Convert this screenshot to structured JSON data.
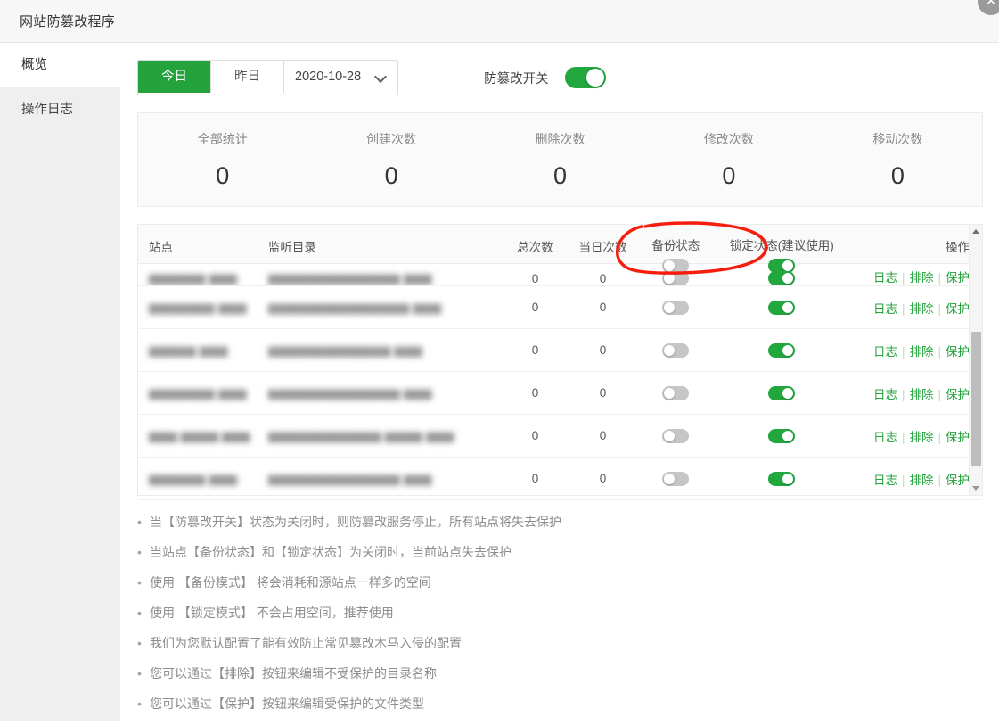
{
  "window": {
    "title": "网站防篡改程序",
    "close_icon": "close-icon"
  },
  "sidebar": {
    "items": [
      {
        "label": "概览",
        "active": true
      },
      {
        "label": "操作日志",
        "active": false
      }
    ]
  },
  "toolbar": {
    "today_label": "今日",
    "yesterday_label": "昨日",
    "date_value": "2020-10-28",
    "date_chevron_icon": "chevron-down-icon",
    "master_switch_label": "防篡改开关",
    "master_switch_state": "on"
  },
  "stats": [
    {
      "label": "全部统计",
      "value": "0"
    },
    {
      "label": "创建次数",
      "value": "0"
    },
    {
      "label": "删除次数",
      "value": "0"
    },
    {
      "label": "修改次数",
      "value": "0"
    },
    {
      "label": "移动次数",
      "value": "0"
    }
  ],
  "table": {
    "columns": {
      "site": "站点",
      "dir": "监听目录",
      "total": "总次数",
      "today": "当日次数",
      "backup": "备份状态",
      "lock": "锁定状态(建议使用)",
      "ops": "操作"
    },
    "header_toggles": {
      "backup_state": "off",
      "lock_state": "on"
    },
    "ops_labels": {
      "log": "日志",
      "exclude": "排除",
      "protect": "保护",
      "separator": "|"
    },
    "rows": [
      {
        "site": "▆▆▆▆▆▆ ▆▆▆",
        "dir": "▆▆▆▆▆▆▆▆▆▆▆▆▆▆ ▆▆▆",
        "total": "0",
        "today": "0",
        "backup": "off",
        "lock": "on",
        "partial": true
      },
      {
        "site": "▆▆▆▆▆▆▆ ▆▆▆",
        "dir": "▆▆▆▆▆▆▆▆▆▆▆▆▆▆▆ ▆▆▆",
        "total": "0",
        "today": "0",
        "backup": "off",
        "lock": "on",
        "partial": false
      },
      {
        "site": "▆▆▆▆▆ ▆▆▆",
        "dir": "▆▆▆▆▆▆▆▆▆▆▆▆▆ ▆▆▆",
        "total": "0",
        "today": "0",
        "backup": "off",
        "lock": "on",
        "partial": false
      },
      {
        "site": "▆▆▆▆▆▆▆ ▆▆▆",
        "dir": "▆▆▆▆▆▆▆▆▆▆▆▆▆▆ ▆▆▆",
        "total": "0",
        "today": "0",
        "backup": "off",
        "lock": "on",
        "partial": false
      },
      {
        "site": "▆▆▆ ▆▆▆▆ ▆▆▆",
        "dir": "▆▆▆▆▆▆▆▆▆▆▆▆ ▆▆▆▆ ▆▆▆",
        "total": "0",
        "today": "0",
        "backup": "off",
        "lock": "on",
        "partial": false
      },
      {
        "site": "▆▆▆▆▆▆ ▆▆▆",
        "dir": "▆▆▆▆▆▆▆▆▆▆▆▆▆▆ ▆▆▆",
        "total": "0",
        "today": "0",
        "backup": "off",
        "lock": "on",
        "partial": false
      }
    ],
    "scrollbar": {
      "up_icon": "scroll-up-arrow-icon",
      "down_icon": "scroll-down-arrow-icon"
    }
  },
  "notes": {
    "bullet": "•",
    "items": [
      "当【防篡改开关】状态为关闭时，则防篡改服务停止，所有站点将失去保护",
      "当站点【备份状态】和【锁定状态】为关闭时，当前站点失去保护",
      "使用 【备份模式】 将会消耗和源站点一样多的空间",
      "使用 【锁定模式】 不会占用空间，推荐使用",
      "我们为您默认配置了能有效防止常见篡改木马入侵的配置",
      "您可以通过【排除】按钮来编辑不受保护的目录名称",
      "您可以通过【保护】按钮来编辑受保护的文件类型"
    ]
  },
  "annotation": {
    "name": "red-circle-highlight",
    "color": "#f61d0c"
  },
  "colors": {
    "accent_green": "#24a23c",
    "toggle_on": "#22a73f",
    "toggle_off": "#c6c6c6",
    "annotation_red": "#f61d0c"
  }
}
